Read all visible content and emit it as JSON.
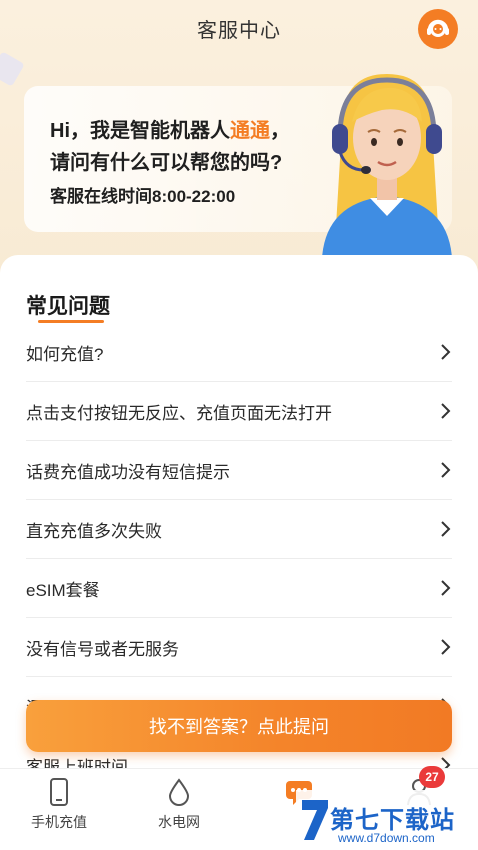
{
  "header": {
    "title": "客服中心"
  },
  "greeting": {
    "line1_prefix": "Hi，我是智能机器人",
    "line1_name": "通通",
    "line1_suffix": "，",
    "line2": "请问有什么可以帮您的吗?",
    "line3": "客服在线时间8:00-22:00"
  },
  "faq": {
    "title": "常见问题",
    "items": [
      {
        "label": "如何充值?"
      },
      {
        "label": "点击支付按钮无反应、充值页面无法打开"
      },
      {
        "label": "话费充值成功没有短信提示"
      },
      {
        "label": "直充充值多次失败"
      },
      {
        "label": "eSIM套餐"
      },
      {
        "label": "没有信号或者无服务"
      },
      {
        "label": "漏… "
      },
      {
        "label": "客服上班时间"
      }
    ]
  },
  "ask_button": {
    "label": "找不到答案？点此提问"
  },
  "tabbar": {
    "tabs": [
      {
        "label": "手机充值",
        "icon": "phone-icon"
      },
      {
        "label": "水电网",
        "icon": "water-drop-icon"
      },
      {
        "label": "",
        "icon": "chat-icon"
      },
      {
        "label": "",
        "icon": "user-icon"
      }
    ],
    "badge": "27"
  },
  "watermark": {
    "title": "第七下载站",
    "url": "www.d7down.com"
  },
  "colors": {
    "accent": "#f47d24",
    "background": "#fbf1e2",
    "badge": "#ea3a3a",
    "watermark": "#1c64c8"
  }
}
